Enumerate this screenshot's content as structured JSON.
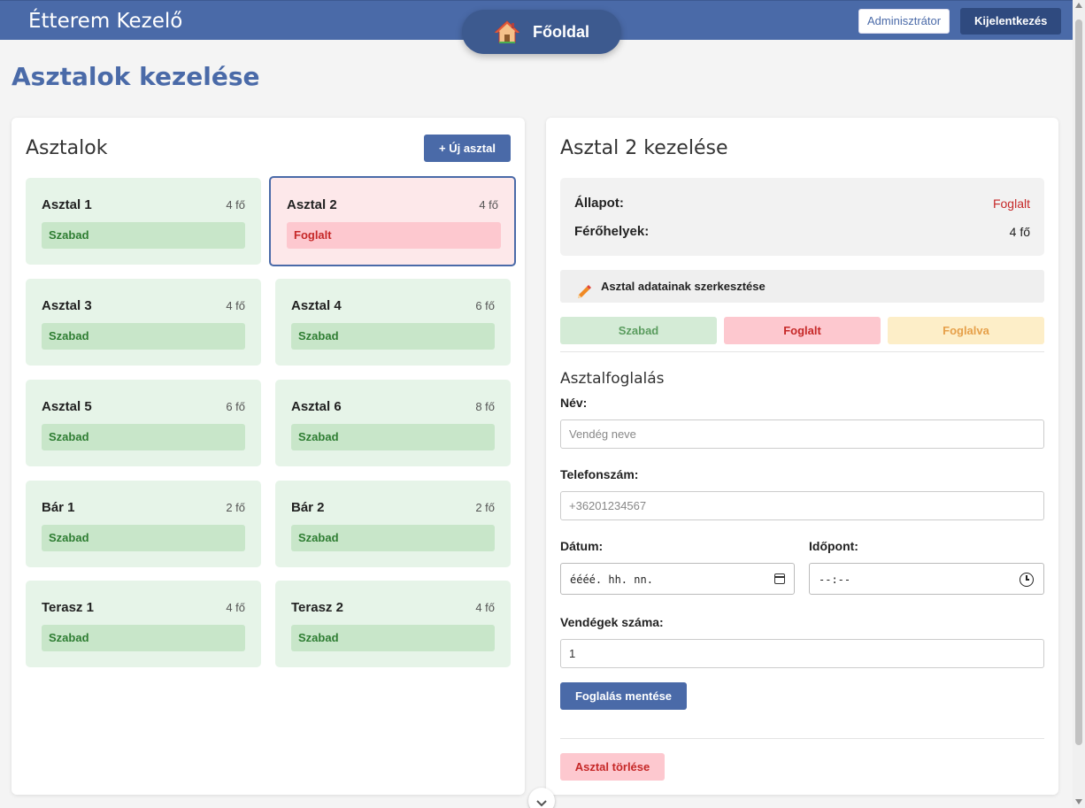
{
  "header": {
    "brand": "Étterem Kezelő",
    "home_label": "Főoldal",
    "admin_label": "Adminisztrátor",
    "logout_label": "Kijelentkezés"
  },
  "page": {
    "title": "Asztalok kezelése"
  },
  "tables_panel": {
    "title": "Asztalok",
    "new_button": "+ Új asztal",
    "tables": [
      {
        "name": "Asztal 1",
        "capacity": "4 fő",
        "status": "Szabad"
      },
      {
        "name": "Asztal 2",
        "capacity": "4 fő",
        "status": "Foglalt"
      },
      {
        "name": "Asztal 3",
        "capacity": "4 fő",
        "status": "Szabad"
      },
      {
        "name": "Asztal 4",
        "capacity": "6 fő",
        "status": "Szabad"
      },
      {
        "name": "Asztal 5",
        "capacity": "6 fő",
        "status": "Szabad"
      },
      {
        "name": "Asztal 6",
        "capacity": "8 fő",
        "status": "Szabad"
      },
      {
        "name": "Bár 1",
        "capacity": "2 fő",
        "status": "Szabad"
      },
      {
        "name": "Bár 2",
        "capacity": "2 fő",
        "status": "Szabad"
      },
      {
        "name": "Terasz 1",
        "capacity": "4 fő",
        "status": "Szabad"
      },
      {
        "name": "Terasz 2",
        "capacity": "4 fő",
        "status": "Szabad"
      }
    ]
  },
  "detail_panel": {
    "title": "Asztal 2 kezelése",
    "state_label": "Állapot:",
    "state_value": "Foglalt",
    "seats_label": "Férőhelyek:",
    "seats_value": "4 fő",
    "edit_label": "Asztal adatainak szerkesztése",
    "status_buttons": {
      "free": "Szabad",
      "busy": "Foglalt",
      "reserved": "Foglalva"
    },
    "booking": {
      "title": "Asztalfoglalás",
      "name_label": "Név:",
      "name_placeholder": "Vendég neve",
      "phone_label": "Telefonszám:",
      "phone_placeholder": "+36201234567",
      "date_label": "Dátum:",
      "date_value": "éééé. hh. nn.",
      "time_label": "Időpont:",
      "time_value": "--:--",
      "guests_label": "Vendégek száma:",
      "guests_value": "1",
      "save_label": "Foglalás mentése"
    },
    "delete_label": "Asztal törlése"
  },
  "colors": {
    "primary": "#4a6aa8",
    "free_bg": "#e6f4e8",
    "free_text": "#2e7d32",
    "busy_bg": "#fdc8cf",
    "busy_text": "#c62828",
    "reserved_bg": "#fdeec8",
    "reserved_text": "#e6a04a"
  }
}
